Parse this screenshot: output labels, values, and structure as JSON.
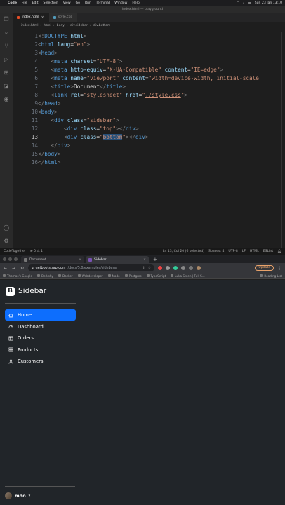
{
  "menubar": {
    "app": "Code",
    "items": [
      "File",
      "Edit",
      "Selection",
      "View",
      "Go",
      "Run",
      "Terminal",
      "Window",
      "Help"
    ],
    "datetime": "Sun 23 Jan  13:10"
  },
  "vscode": {
    "window_title": "index.html — playground",
    "tabs": [
      {
        "label": "index.html",
        "active": true
      },
      {
        "label": "style.css",
        "active": false
      }
    ],
    "breadcrumb": [
      "index.html",
      "html",
      "body",
      "div.sidebar",
      "div.bottom"
    ],
    "lines": [
      {
        "n": "1"
      },
      {
        "n": "2"
      },
      {
        "n": "3"
      },
      {
        "n": "4"
      },
      {
        "n": "5"
      },
      {
        "n": "6"
      },
      {
        "n": "7"
      },
      {
        "n": "8"
      },
      {
        "n": "9"
      },
      {
        "n": "10"
      },
      {
        "n": "11"
      },
      {
        "n": "12"
      },
      {
        "n": "13"
      },
      {
        "n": "14"
      },
      {
        "n": "15"
      },
      {
        "n": "16"
      }
    ],
    "code": {
      "doctype": "<!DOCTYPE html>",
      "html_open_lang": "en",
      "meta_charset": "UTF-8",
      "meta_xua_equiv": "X-UA-Compatible",
      "meta_xua_content": "IE=edge",
      "meta_viewport_name": "viewport",
      "meta_viewport_content": "width=device-width, initial-scale",
      "title_text": "Document",
      "link_rel": "stylesheet",
      "link_href": "./style.css",
      "div_sidebar": "sidebar",
      "div_top": "top",
      "div_bottom": "bottom"
    },
    "status": {
      "left": "CodeTogether",
      "problems": "⊗ 0 ⚠ 1",
      "position": "Ln 13, Col 20 (6 selected)",
      "spaces": "Spaces: 4",
      "encoding": "UTF-8",
      "eol": "LF",
      "lang": "HTML",
      "lint": "ESLint"
    }
  },
  "chrome": {
    "tabs": [
      {
        "label": "Document",
        "active": false
      },
      {
        "label": "Sidebar",
        "active": true
      }
    ],
    "url_host": "getbootstrap.com",
    "url_path": "/docs/5.0/examples/sidebars/",
    "update_label": "Update",
    "bookmarks": [
      "Thomas's Google",
      "Berkshy",
      "Docker",
      "Webdeveloper",
      "Node",
      "Postgres",
      "TypeScript",
      "Luka Steen | Full S..."
    ],
    "reading_list": "Reading List"
  },
  "page": {
    "brand_letter": "B",
    "brand_name": "Sidebar",
    "nav": [
      {
        "label": "Home",
        "icon": "home-icon",
        "active": true
      },
      {
        "label": "Dashboard",
        "icon": "speedometer-icon",
        "active": false
      },
      {
        "label": "Orders",
        "icon": "table-icon",
        "active": false
      },
      {
        "label": "Products",
        "icon": "grid-icon",
        "active": false
      },
      {
        "label": "Customers",
        "icon": "people-icon",
        "active": false
      }
    ],
    "user": "mdo",
    "accent": "#0d6efd"
  }
}
